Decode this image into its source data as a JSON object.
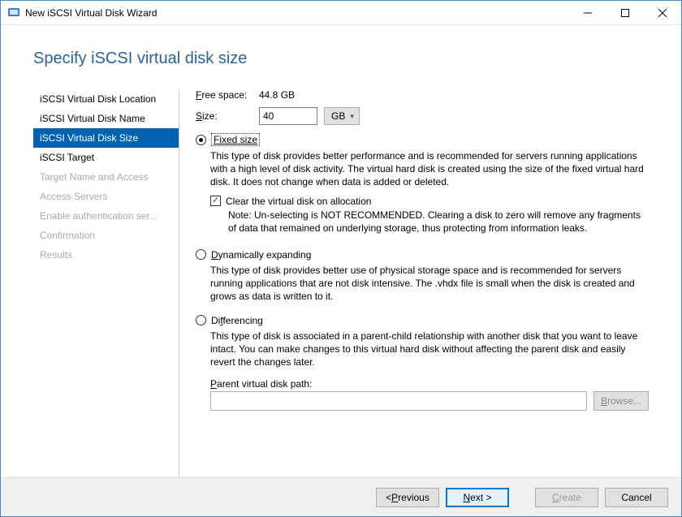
{
  "titlebar": {
    "title": "New iSCSI Virtual Disk Wizard"
  },
  "page": {
    "heading": "Specify iSCSI virtual disk size"
  },
  "sidebar": {
    "steps": [
      {
        "label": "iSCSI Virtual Disk Location",
        "state": ""
      },
      {
        "label": "iSCSI Virtual Disk Name",
        "state": ""
      },
      {
        "label": "iSCSI Virtual Disk Size",
        "state": "selected"
      },
      {
        "label": "iSCSI Target",
        "state": ""
      },
      {
        "label": "Target Name and Access",
        "state": "disabled"
      },
      {
        "label": "Access Servers",
        "state": "disabled"
      },
      {
        "label": "Enable authentication ser...",
        "state": "disabled"
      },
      {
        "label": "Confirmation",
        "state": "disabled"
      },
      {
        "label": "Results",
        "state": "disabled"
      }
    ]
  },
  "main": {
    "free_space_label": "Free space:",
    "free_space_value": "44.8 GB",
    "size_label": "Size:",
    "size_value": "40",
    "size_unit": "GB",
    "options": {
      "fixed": {
        "label": "Fixed size",
        "selected": true,
        "desc": "This type of disk provides better performance and is recommended for servers running applications with a high level of disk activity. The virtual hard disk is created using the size of the fixed virtual hard disk. It does not change when data is added or deleted.",
        "clear_label": "Clear the virtual disk on allocation",
        "clear_checked": true,
        "clear_note": "Note: Un-selecting is NOT RECOMMENDED. Clearing a disk to zero will remove any fragments of data that remained on underlying storage, thus protecting from information leaks."
      },
      "dynamic": {
        "label": "Dynamically expanding",
        "selected": false,
        "desc": "This type of disk provides better use of physical storage space and is recommended for servers running applications that are not disk intensive. The .vhdx file is small when the disk is created and grows as data is written to it."
      },
      "differencing": {
        "label": "Differencing",
        "selected": false,
        "desc": "This type of disk is associated in a parent-child relationship with another disk that you want to leave intact. You can make changes to this virtual hard disk without affecting the parent disk and easily revert the changes later.",
        "parent_path_label": "Parent virtual disk path:",
        "parent_path_value": "",
        "browse_label": "Browse..."
      }
    }
  },
  "footer": {
    "previous": "< Previous",
    "next": "Next >",
    "create": "Create",
    "cancel": "Cancel"
  }
}
